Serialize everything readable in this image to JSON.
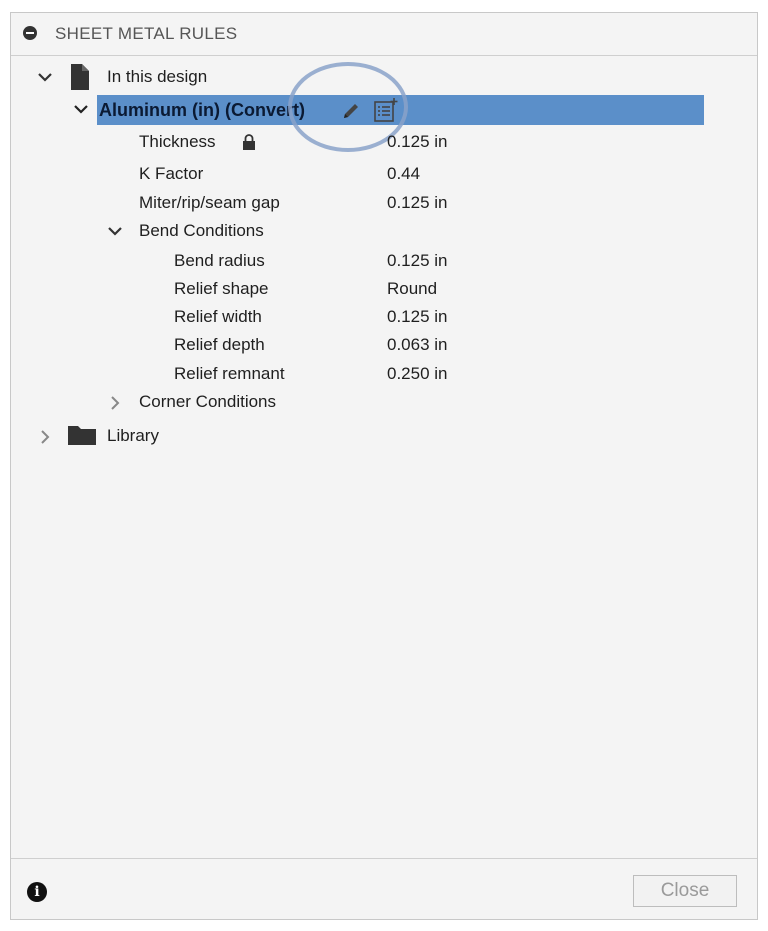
{
  "panel": {
    "title": "SHEET METAL RULES"
  },
  "tree": {
    "in_this_design": "In this design",
    "rule_name": "Aluminum (in) (Convert)",
    "props": [
      {
        "label": "Thickness",
        "value": "0.125 in",
        "locked": true
      },
      {
        "label": "K Factor",
        "value": "0.44"
      },
      {
        "label": "Miter/rip/seam gap",
        "value": "0.125 in"
      }
    ],
    "bend_conditions": {
      "label": "Bend Conditions",
      "items": [
        {
          "label": "Bend radius",
          "value": "0.125 in"
        },
        {
          "label": "Relief shape",
          "value": "Round"
        },
        {
          "label": "Relief width",
          "value": "0.125 in"
        },
        {
          "label": "Relief depth",
          "value": "0.063 in"
        },
        {
          "label": "Relief remnant",
          "value": "0.250 in"
        }
      ]
    },
    "corner_conditions": "Corner Conditions",
    "library": "Library"
  },
  "footer": {
    "close_label": "Close"
  },
  "colors": {
    "selection": "#5b8fc9",
    "highlight_circle": "#8aa2c9"
  }
}
